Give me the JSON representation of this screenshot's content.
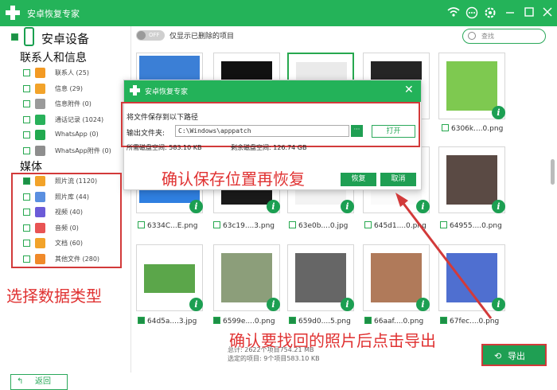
{
  "app": {
    "title": "安卓恢复专家",
    "icons": [
      "wifi-icon",
      "chat-icon",
      "gear-icon",
      "minimize-icon",
      "maximize-icon",
      "close-icon"
    ]
  },
  "sidebar": {
    "device": "安卓设备",
    "contacts_section": "联系人和信息",
    "contacts_items": [
      {
        "label": "联系人 (25)",
        "icon": "contacts-icon",
        "color": "#f39a23"
      },
      {
        "label": "信息 (29)",
        "icon": "message-icon",
        "color": "#f2a32a"
      },
      {
        "label": "信息附件 (0)",
        "icon": "attachment-icon",
        "color": "#9a9a9a"
      },
      {
        "label": "通话记录 (1024)",
        "icon": "phone-icon",
        "color": "#28b15a"
      },
      {
        "label": "WhatsApp (0)",
        "icon": "whatsapp-icon",
        "color": "#21a94f"
      },
      {
        "label": "WhatsApp附件 (0)",
        "icon": "whatsapp-attachment-icon",
        "color": "#8e8e8e"
      }
    ],
    "media_section": "媒体",
    "media_items": [
      {
        "label": "照片流 (1120)",
        "icon": "star-icon",
        "color": "#f2a32a",
        "checked": true
      },
      {
        "label": "照片库 (44)",
        "icon": "gallery-icon",
        "color": "#5a8fe0"
      },
      {
        "label": "视频 (40)",
        "icon": "video-icon",
        "color": "#6b5bd8"
      },
      {
        "label": "音频 (0)",
        "icon": "audio-icon",
        "color": "#e85454"
      },
      {
        "label": "文档 (60)",
        "icon": "folder-icon",
        "color": "#f2a32a"
      },
      {
        "label": "其他文件 (280)",
        "icon": "file-icon",
        "color": "#f08a2a"
      }
    ],
    "back": "返回"
  },
  "toolbar": {
    "toggle": "OFF",
    "toggle_label": "仅显示已删除的项目",
    "search_placeholder": "查找"
  },
  "files": {
    "row2": [
      "6334C...E.png",
      "63c19....3.png",
      "63e0b....0.jpg",
      "645d1....0.png",
      "64955....0.png"
    ],
    "row3": [
      "64d5a....3.jpg",
      "6599e....0.png",
      "659d0....5.png",
      "66aaf....0.png",
      "67fec....0.png"
    ],
    "row1_last": "6306k....0.png"
  },
  "dialog": {
    "title": "安卓恢复专家",
    "save_to": "将文件保存到以下路径",
    "output_label": "输出文件夹:",
    "path": "C:\\Windows\\apppatch",
    "dots": "···",
    "open": "打开",
    "needed": "所需磁盘空间:  583.10 KB",
    "remaining": "剩余磁盘空间:  126.74 GB",
    "recover": "恢复",
    "cancel": "取消"
  },
  "footer": {
    "total": "总计: 2622个项目754.21 MB",
    "selected": "选定的项目: 9个项目583.10 KB",
    "export": "导出"
  },
  "annotations": {
    "a1": "确认保存位置再恢复",
    "a2": "选择数据类型",
    "a3": "确认要找回的照片后点击导出"
  }
}
